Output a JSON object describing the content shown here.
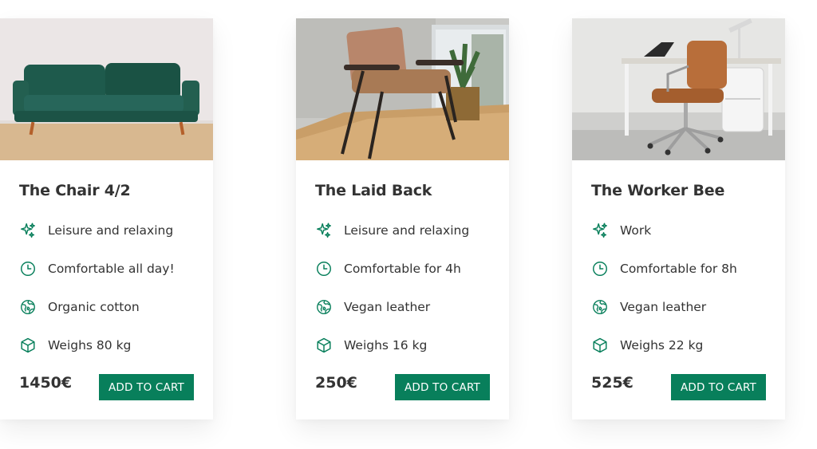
{
  "products": [
    {
      "title": "The Laid Back",
      "attributes": [
        {
          "icon": "sparkles-icon",
          "text": "Leisure and relaxing"
        },
        {
          "icon": "clock-icon",
          "text": "Comfortable for 4h"
        },
        {
          "icon": "globe-icon",
          "text": "Vegan leather"
        },
        {
          "icon": "cube-icon",
          "text": "Weighs 16 kg"
        }
      ],
      "price": "250€",
      "button_label": "ADD TO CART"
    },
    {
      "title": "The Worker Bee",
      "attributes": [
        {
          "icon": "sparkles-icon",
          "text": "Work"
        },
        {
          "icon": "clock-icon",
          "text": "Comfortable for 8h"
        },
        {
          "icon": "globe-icon",
          "text": "Vegan leather"
        },
        {
          "icon": "cube-icon",
          "text": "Weighs 22 kg"
        }
      ],
      "price": "525€",
      "button_label": "ADD TO CART"
    },
    {
      "title": "The Chair 4/2",
      "attributes": [
        {
          "icon": "sparkles-icon",
          "text": "Leisure and relaxing"
        },
        {
          "icon": "clock-icon",
          "text": "Comfortable all day!"
        },
        {
          "icon": "globe-icon",
          "text": "Organic cotton"
        },
        {
          "icon": "cube-icon",
          "text": "Weighs 80 kg"
        }
      ],
      "price": "1450€",
      "button_label": "ADD TO CART"
    }
  ],
  "colors": {
    "accent": "#087f5b",
    "text": "#333333",
    "card_bg": "#ffffff"
  }
}
